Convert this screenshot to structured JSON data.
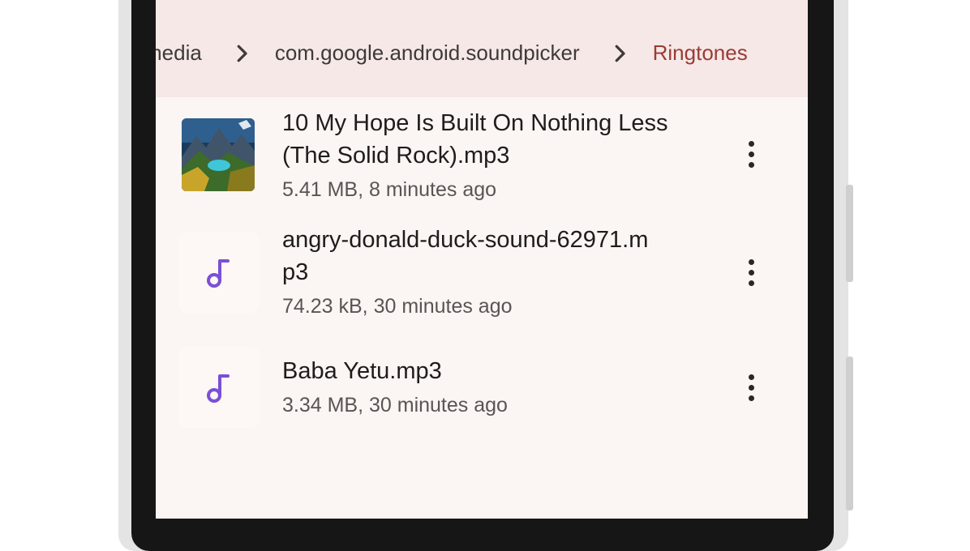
{
  "breadcrumb": {
    "items": [
      "media",
      "com.google.android.soundpicker",
      "Ringtones"
    ],
    "separator_icon": "chevron-right-icon"
  },
  "files": [
    {
      "name_line1": "10 My Hope Is Built On Nothing Less",
      "name_line2": "(The Solid Rock).mp3",
      "meta": "5.41 MB, 8 minutes ago",
      "icon": "album-art-thumbnail"
    },
    {
      "name_line1": "angry-donald-duck-sound-62971.m",
      "name_line2": "p3",
      "meta": "74.23 kB, 30 minutes ago",
      "icon": "music-note-icon"
    },
    {
      "name_line1": "Baba Yetu.mp3",
      "meta": "3.34 MB, 30 minutes ago",
      "icon": "music-note-icon"
    }
  ],
  "colors": {
    "breadcrumb_active": "#9b3b35",
    "music_note": "#7b4fd6",
    "app_bar": "#f5e8e6",
    "list_background": "#fbf5f3"
  }
}
